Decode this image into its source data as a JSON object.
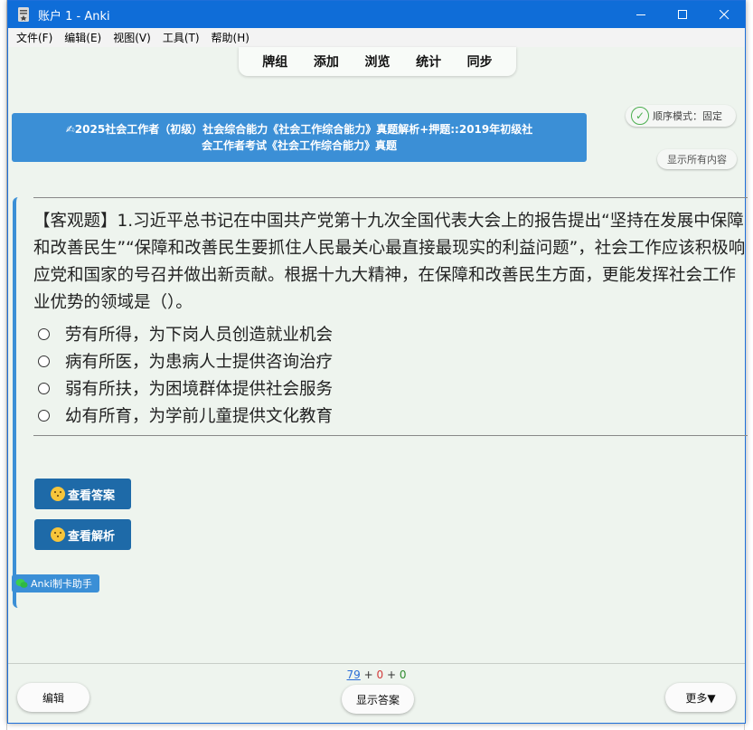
{
  "window": {
    "title": "账户 1 - Anki"
  },
  "menu": [
    "文件(F)",
    "编辑(E)",
    "视图(V)",
    "工具(T)",
    "帮助(H)"
  ],
  "toolbar": [
    "牌组",
    "添加",
    "浏览",
    "统计",
    "同步"
  ],
  "deck_title_line1": "✍2025社会工作者（初级）社会综合能力《社会工作综合能力》真题解析+押题::2019年初级社",
  "deck_title_line2": "会工作者考试《社会工作综合能力》真题",
  "mode_label": "顺序模式：固定",
  "show_all_label": "显示所有内容",
  "question_text": "【客观题】1.习近平总书记在中国共产党第十九次全国代表大会上的报告提出“坚持在发展中保障和改善民生”“保障和改善民生要抓住人民最关心最直接最现实的利益问题”，社会工作应该积极响应党和国家的号召并做出新贡献。根据十九大精神，在保障和改善民生方面，更能发挥社会工作业优势的领域是（）。",
  "options": [
    "劳有所得，为下岗人员创造就业机会",
    "病有所医，为患病人士提供咨询治疗",
    "弱有所扶，为困境群体提供社会服务",
    "幼有所育，为学前儿童提供文化教育"
  ],
  "buttons": {
    "view_answer": "查看答案",
    "view_explanation": "查看解析"
  },
  "helper_label": "Anki制卡助手",
  "counts": {
    "new": "79",
    "learn": "0",
    "review": "0",
    "plus": "+"
  },
  "bottom": {
    "edit": "编辑",
    "show_answer": "显示答案",
    "more": "更多▼"
  },
  "colors": {
    "titlebar": "#0f6dd8",
    "accent": "#3b8fd6",
    "button_blue": "#1e6aa8",
    "background": "#eef4ee"
  }
}
